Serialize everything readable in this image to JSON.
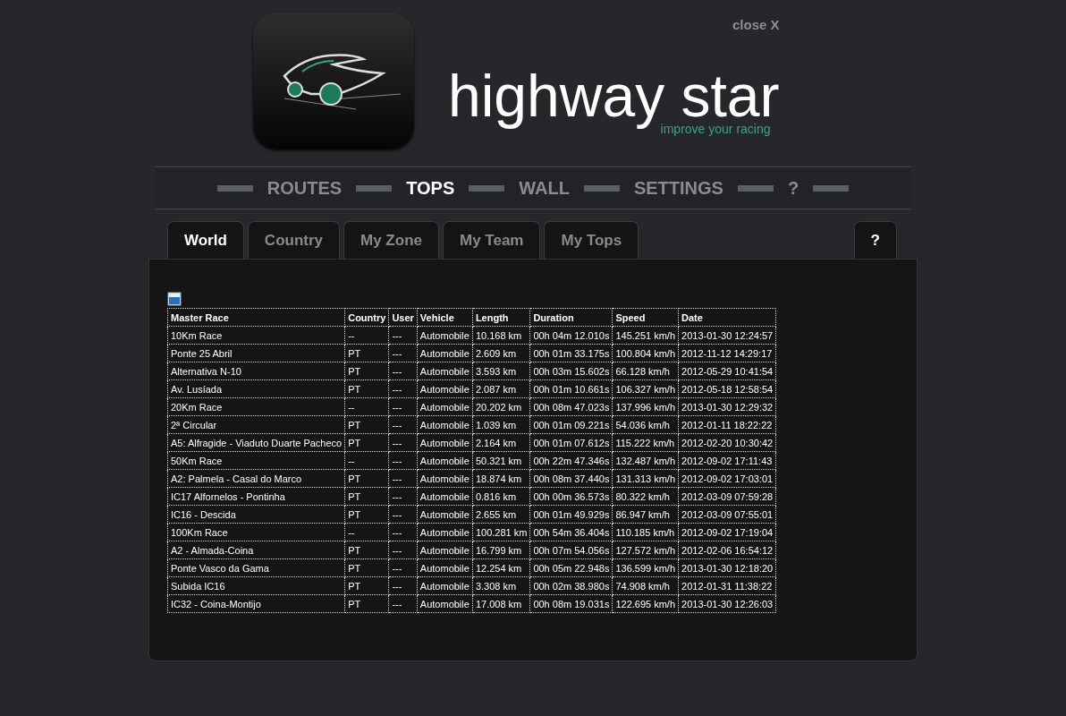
{
  "header": {
    "close_label": "close X",
    "app_title": "highway star",
    "tagline": "improve your racing"
  },
  "nav": [
    {
      "label": "ROUTES",
      "selected": false
    },
    {
      "label": "TOPS",
      "selected": true
    },
    {
      "label": "WALL",
      "selected": false
    },
    {
      "label": "SETTINGS",
      "selected": false
    },
    {
      "label": "?",
      "selected": false
    }
  ],
  "tabs": [
    {
      "label": "World",
      "selected": true
    },
    {
      "label": "Country",
      "selected": false
    },
    {
      "label": "My Zone",
      "selected": false
    },
    {
      "label": "My Team",
      "selected": false
    },
    {
      "label": "My Tops",
      "selected": false
    }
  ],
  "help_tab": {
    "label": "?"
  },
  "table": {
    "columns": [
      "Master Race",
      "Country",
      "User",
      "Vehicle",
      "Length",
      "Duration",
      "Speed",
      "Date"
    ],
    "rows": [
      [
        "10Km Race",
        "--",
        "---",
        "Automobile",
        "10.168 km",
        "00h 04m 12.010s",
        "145.251 km/h",
        "2013-01-30 12:24:57"
      ],
      [
        "Ponte 25 Abril",
        "PT",
        "---",
        "Automobile",
        "2.609 km",
        "00h 01m 33.175s",
        "100.804 km/h",
        "2012-11-12 14:29:17"
      ],
      [
        "Alternativa N-10",
        "PT",
        "---",
        "Automobile",
        "3.593 km",
        "00h 03m 15.602s",
        "66.128 km/h",
        "2012-05-29 10:41:54"
      ],
      [
        "Av. Lusíada",
        "PT",
        "---",
        "Automobile",
        "2.087 km",
        "00h 01m 10.661s",
        "106.327 km/h",
        "2012-05-18 12:58:54"
      ],
      [
        "20Km Race",
        "--",
        "---",
        "Automobile",
        "20.202 km",
        "00h 08m 47.023s",
        "137.996 km/h",
        "2013-01-30 12:29:32"
      ],
      [
        "2ª Circular",
        "PT",
        "---",
        "Automobile",
        "1.039 km",
        "00h 01m 09.221s",
        "54.036 km/h",
        "2012-01-11 18:22:22"
      ],
      [
        "A5: Alfragide - Viaduto Duarte Pacheco",
        "PT",
        "---",
        "Automobile",
        "2.164 km",
        "00h 01m 07.612s",
        "115.222 km/h",
        "2012-02-20 10:30:42"
      ],
      [
        "50Km Race",
        "--",
        "---",
        "Automobile",
        "50.321 km",
        "00h 22m 47.346s",
        "132.487 km/h",
        "2012-09-02 17:11:43"
      ],
      [
        "A2: Palmela - Casal do Marco",
        "PT",
        "---",
        "Automobile",
        "18.874 km",
        "00h 08m 37.440s",
        "131.313 km/h",
        "2012-09-02 17:03:01"
      ],
      [
        "IC17 Alfornelos - Pontinha",
        "PT",
        "---",
        "Automobile",
        "0.816 km",
        "00h 00m 36.573s",
        "80.322 km/h",
        "2012-03-09 07:59:28"
      ],
      [
        "IC16 - Descida",
        "PT",
        "---",
        "Automobile",
        "2.655 km",
        "00h 01m 49.929s",
        "86.947 km/h",
        "2012-03-09 07:55:01"
      ],
      [
        "100Km Race",
        "--",
        "---",
        "Automobile",
        "100.281 km",
        "00h 54m 36.404s",
        "110.185 km/h",
        "2012-09-02 17:19:04"
      ],
      [
        "A2 - Almada-Coina",
        "PT",
        "---",
        "Automobile",
        "16.799 km",
        "00h 07m 54.056s",
        "127.572 km/h",
        "2012-02-06 16:54:12"
      ],
      [
        "Ponte Vasco da Gama",
        "PT",
        "---",
        "Automobile",
        "12.254 km",
        "00h 05m 22.948s",
        "136.599 km/h",
        "2013-01-30 12:18:20"
      ],
      [
        "Subida IC16",
        "PT",
        "---",
        "Automobile",
        "3.308 km",
        "00h 02m 38.980s",
        "74.908 km/h",
        "2012-01-31 11:38:22"
      ],
      [
        "IC32 - Coina-Montijo",
        "PT",
        "---",
        "Automobile",
        "17.008 km",
        "00h 08m 19.031s",
        "122.695 km/h",
        "2013-01-30 12:26:03"
      ]
    ]
  }
}
